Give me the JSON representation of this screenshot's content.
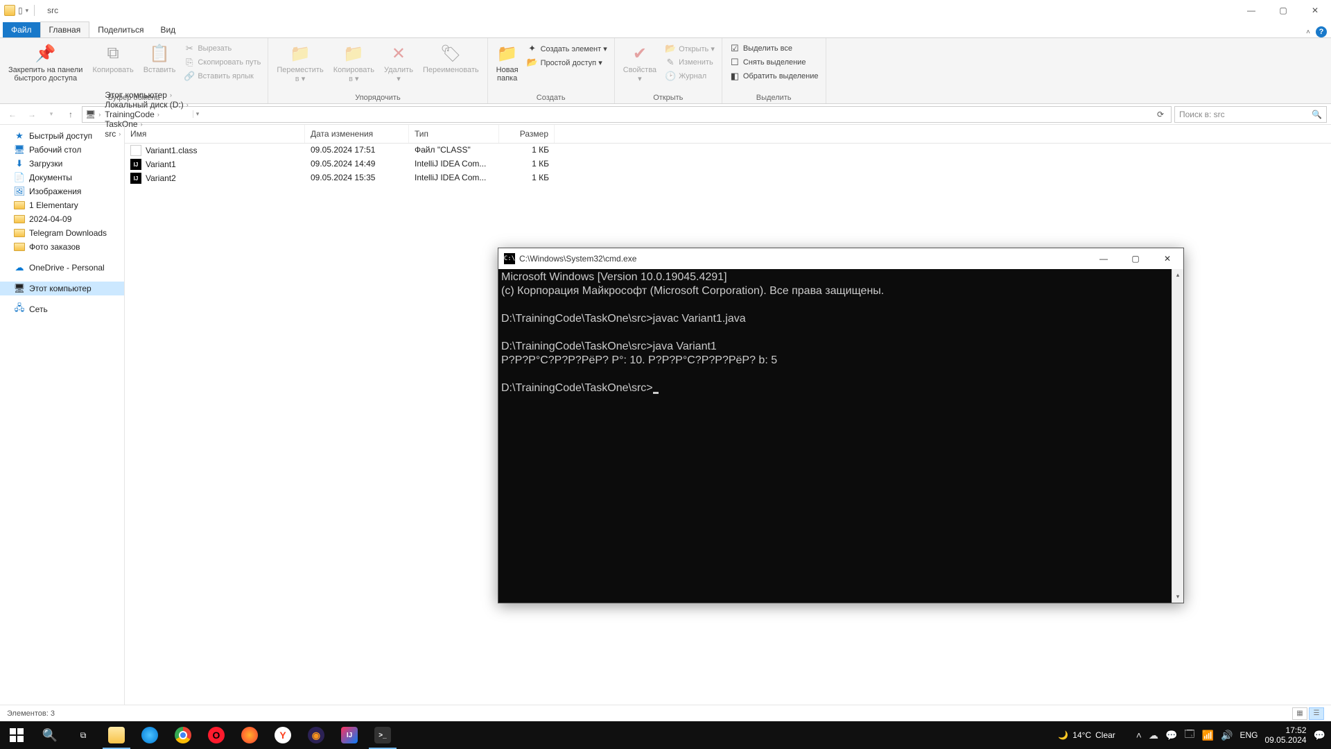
{
  "window": {
    "title": "src",
    "min": "—",
    "max": "▢",
    "close": "✕"
  },
  "tabs": {
    "file": "Файл",
    "home": "Главная",
    "share": "Поделиться",
    "view": "Вид"
  },
  "ribbon": {
    "clipboard": {
      "pin": "Закрепить на панели\nбыстрого доступа",
      "copy": "Копировать",
      "paste": "Вставить",
      "cut": "Вырезать",
      "copypath": "Скопировать путь",
      "pastelnk": "Вставить ярлык",
      "label": "Буфер обмена"
    },
    "organize": {
      "move": "Переместить\nв ▾",
      "copyto": "Копировать\nв ▾",
      "delete": "Удалить\n▾",
      "rename": "Переименовать",
      "label": "Упорядочить"
    },
    "new": {
      "folder": "Новая\nпапка",
      "newitem": "Создать элемент ▾",
      "easy": "Простой доступ ▾",
      "label": "Создать"
    },
    "open": {
      "props": "Свойства\n▾",
      "open": "Открыть ▾",
      "edit": "Изменить",
      "history": "Журнал",
      "label": "Открыть"
    },
    "select": {
      "all": "Выделить все",
      "none": "Снять выделение",
      "invert": "Обратить выделение",
      "label": "Выделить"
    }
  },
  "address": {
    "segs": [
      "Этот компьютер",
      "Локальный диск (D:)",
      "TrainingCode",
      "TaskOne",
      "src"
    ],
    "search_placeholder": "Поиск в: src"
  },
  "nav": {
    "quick": "Быстрый доступ",
    "desktop": "Рабочий стол",
    "downloads": "Загрузки",
    "documents": "Документы",
    "pictures": "Изображения",
    "f1": "1 Elementary",
    "f2": "2024-04-09",
    "f3": "Telegram Downloads",
    "f4": "Фото заказов",
    "onedrive": "OneDrive - Personal",
    "thispc": "Этот компьютер",
    "network": "Сеть"
  },
  "columns": {
    "name": "Имя",
    "date": "Дата изменения",
    "type": "Тип",
    "size": "Размер"
  },
  "files": [
    {
      "name": "Variant1.class",
      "date": "09.05.2024 17:51",
      "type": "Файл \"CLASS\"",
      "size": "1 КБ",
      "icon": "file"
    },
    {
      "name": "Variant1",
      "date": "09.05.2024 14:49",
      "type": "IntelliJ IDEA Com...",
      "size": "1 КБ",
      "icon": "ij"
    },
    {
      "name": "Variant2",
      "date": "09.05.2024 15:35",
      "type": "IntelliJ IDEA Com...",
      "size": "1 КБ",
      "icon": "ij"
    }
  ],
  "status": {
    "items": "Элементов: 3"
  },
  "cmd": {
    "title": "C:\\Windows\\System32\\cmd.exe",
    "lines": "Microsoft Windows [Version 10.0.19045.4291]\n(c) Корпорация Майкрософт (Microsoft Corporation). Все права защищены.\n\nD:\\TrainingCode\\TaskOne\\src>javac Variant1.java\n\nD:\\TrainingCode\\TaskOne\\src>java Variant1\nР?Р?Р°С?Р?Р?РёР? Р°: 10. Р?Р?Р°С?Р?Р?РёР? b: 5\n\nD:\\TrainingCode\\TaskOne\\src>"
  },
  "taskbar": {
    "weather_temp": "14°C",
    "weather_text": "Clear",
    "lang": "ENG",
    "time": "17:52",
    "date": "09.05.2024"
  }
}
